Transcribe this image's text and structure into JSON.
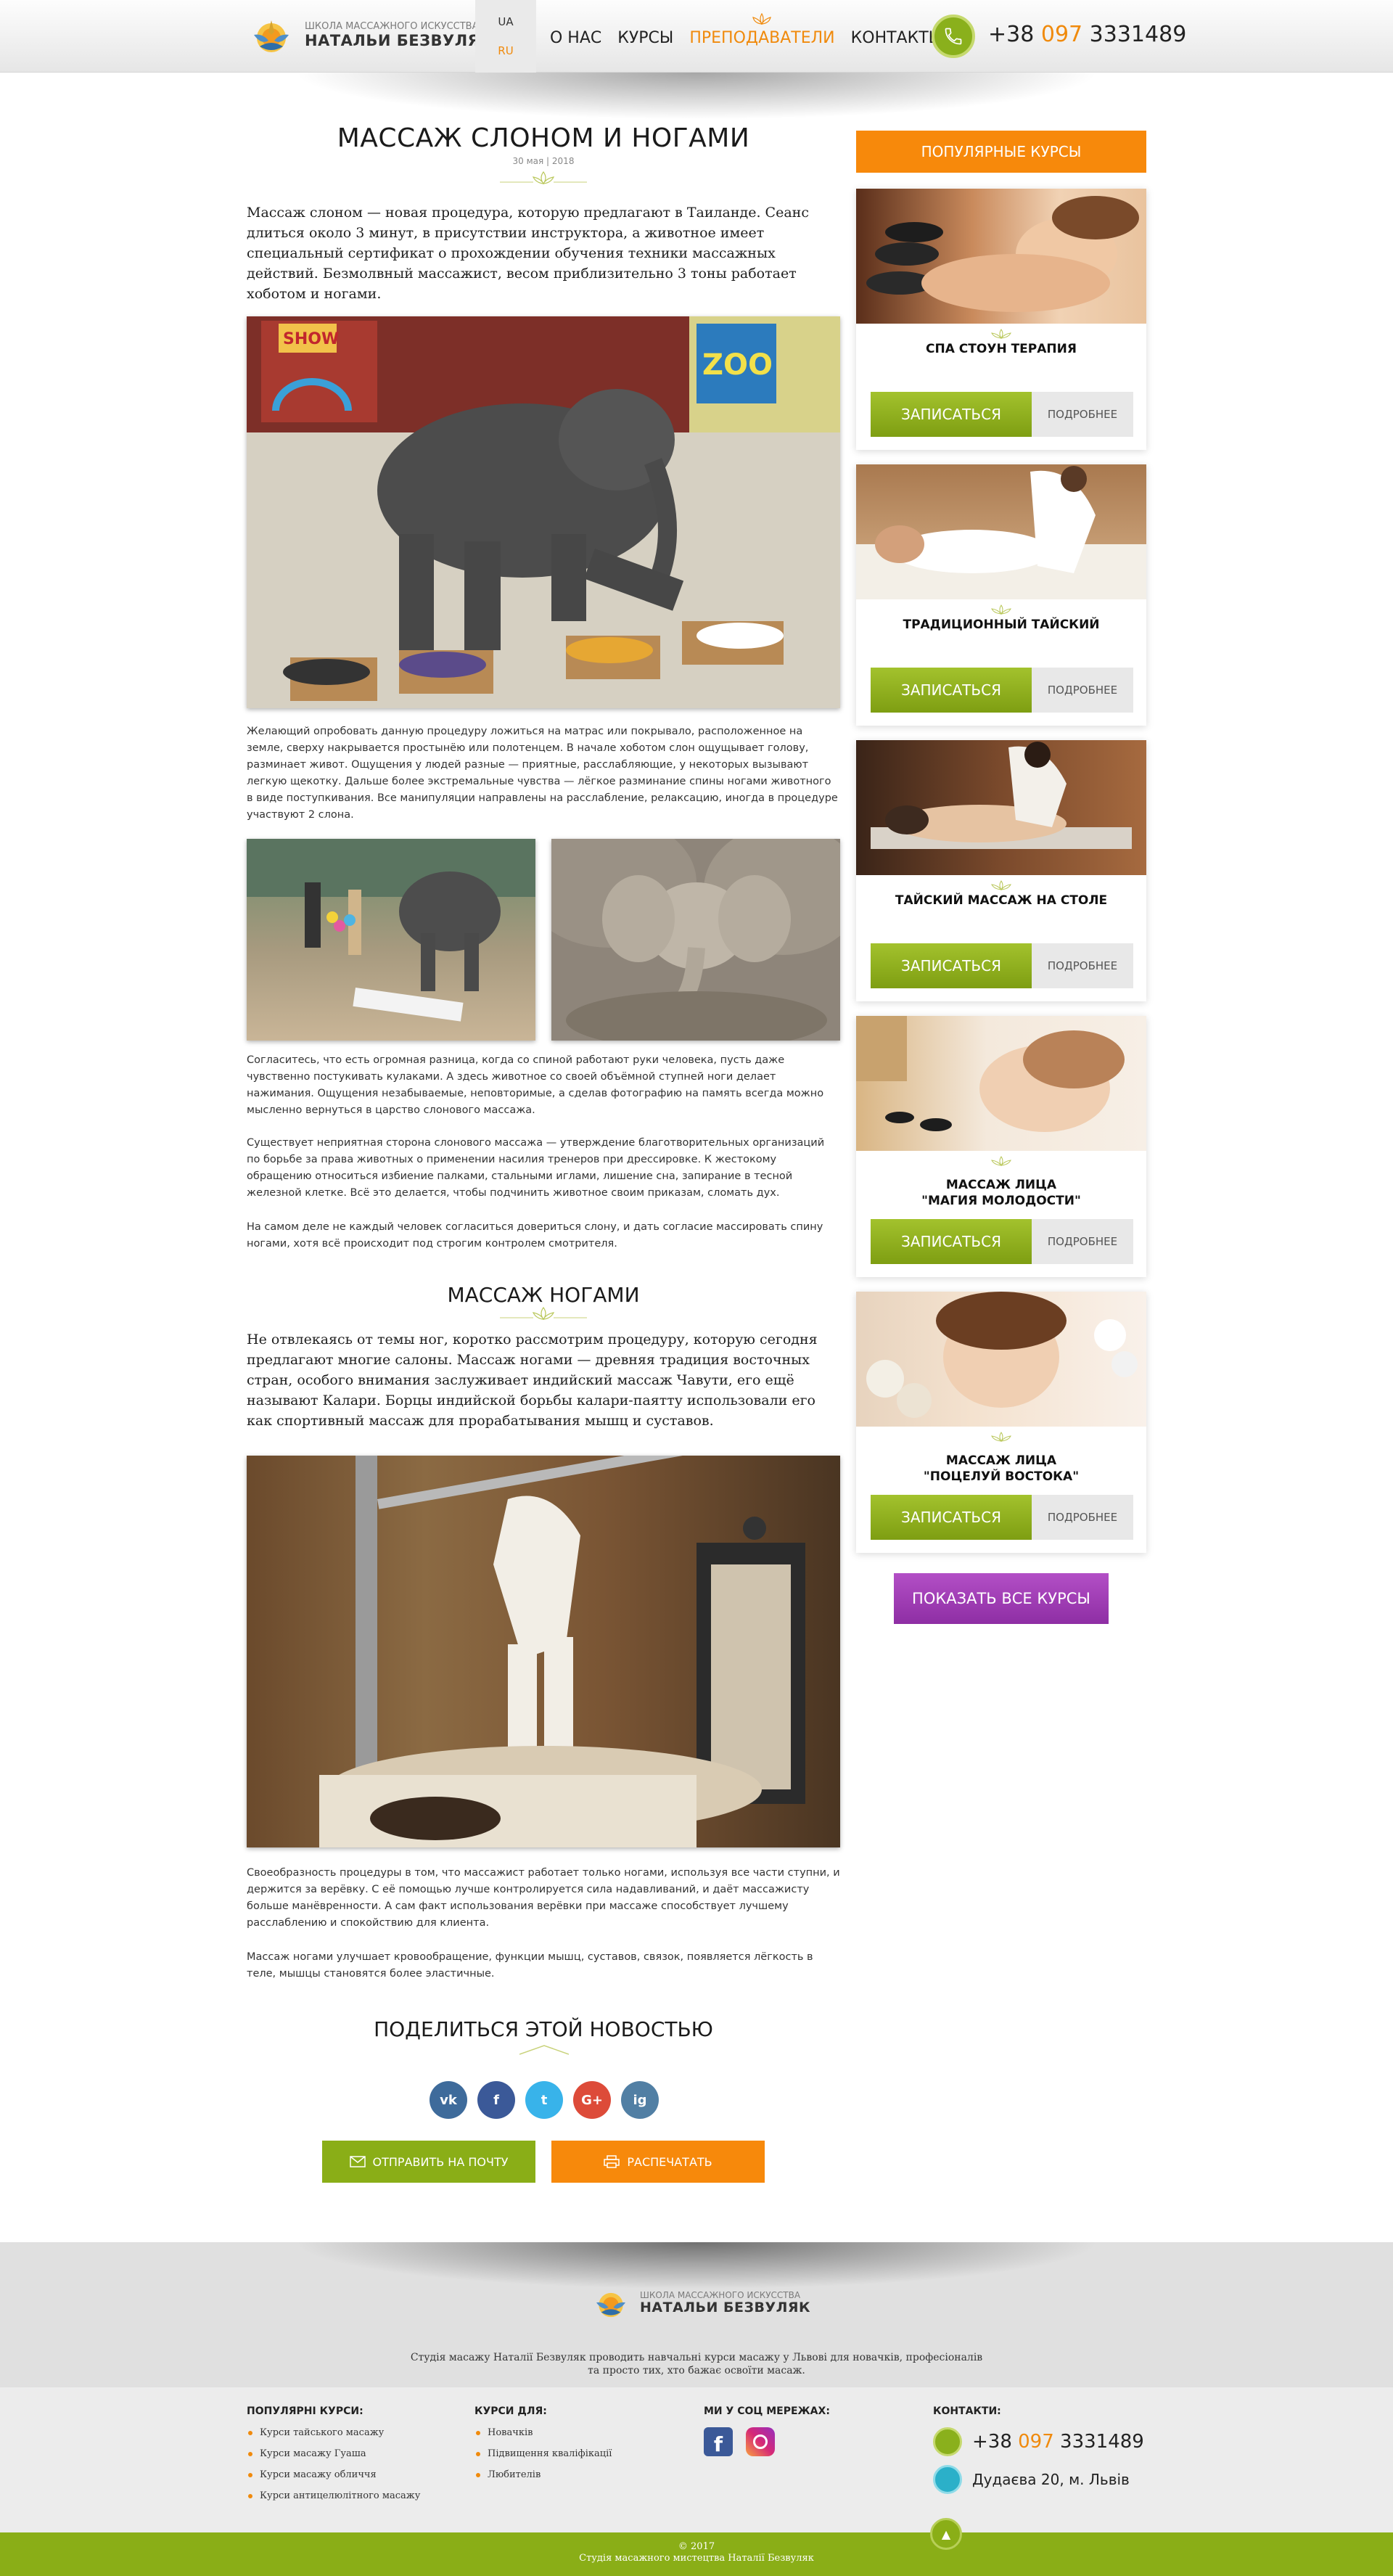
{
  "header": {
    "logo_sub": "ШКОЛА МАССАЖНОГО ИСКУССТВА",
    "logo_main": "НАТАЛЬИ БЕЗВУЛЯК",
    "lang_ua": "UA",
    "lang_ru": "RU",
    "nav": [
      "О НАС",
      "КУРСЫ",
      "ПРЕПОДАВАТЕЛИ",
      "КОНТАКТЫ"
    ],
    "phone_prefix": "+38",
    "phone_op": "097",
    "phone_num": "3331489"
  },
  "article": {
    "title": "МАССАЖ СЛОНОМ И НОГАМИ",
    "date": "30 мая | 2018",
    "lead": "Массаж слоном — новая процедура, которую предлагают в Таиланде. Сеанс длиться около 3 минут, в присутствии инструктора, а животное имеет специальный сертификат о прохождении обучения техники массажных действий. Безмолвный массажист, весом приблизительно 3 тоны работает хоботом и ногами.",
    "p1": "Желающий опробовать данную процедуру ложиться на матрас или покрывало, расположенное на земле, сверху накрывается простынёю или полотенцем. В начале хоботом слон ощущывает голову, разминает живот. Ощущения у людей разные — приятные, расслабляющие, у некоторых вызывают легкую щекотку. Дальше более экстремальные чувства — лёгкое разминание спины ногами животного в виде поступкивания. Все манипуляции направлены на расслабление, релаксацию, иногда в процедуре участвуют 2 слона.",
    "p2": "Согласитесь, что есть огромная разница, когда со спиной работают руки человека, пусть даже чувственно постукивать кулаками. А здесь животное со своей объёмной ступней ноги делает нажимания. Ощущения незабываемые, неповторимые, а сделав фотографию на память всегда можно мысленно вернуться в царство слонового массажа.",
    "p3": "Существует неприятная сторона слонового массажа — утверждение благотворительных организаций по борьбе за права животных о применении насилия тренеров при дрессировке. К жестокому обращению относиться избиение палками, стальными иглами, лишение сна, запирание в тесной железной клетке. Всё это делается, чтобы подчинить животное своим приказам, сломать дух.",
    "p4": "На самом деле не каждый человек согласиться довериться слону, и дать согласие массировать спину ногами, хотя всё происходит под строгим контролем смотрителя.",
    "h2": "МАССАЖ НОГАМИ",
    "lead2": "Не отвлекаясь от темы ног, коротко рассмотрим процедуру, которую сегодня предлагают многие салоны. Массаж ногами — древняя традиция восточных стран, особого внимания заслуживает индийский массаж Чавути, его ещё называют Калари. Борцы индийской борьбы калари-паятту использовали его как спортивный массаж для прорабатывания мышц и суставов.",
    "p5": "Своеобразность процедуры в том, что массажист работает только ногами, используя все части ступни, и держится за верёвку. С её помощью лучше контролируется сила надавливаний, и даёт массажисту больше манёвренности. А сам факт использования верёвки при массаже способствует лучшему расслаблению и спокойствию для клиента.",
    "p6": "Массаж ногами улучшает кровообращение, функции мышц, суставов, связок, появляется лёгкость в теле, мышцы становятся более эластичные.",
    "share_title": "ПОДЕЛИТЬСЯ ЭТОЙ НОВОСТЬЮ",
    "social": [
      "vk",
      "f",
      "t",
      "G+",
      "ig"
    ],
    "send_btn": "ОТПРАВИТЬ НА ПОЧТУ",
    "print_btn": "РАСПЕЧАТАТЬ",
    "zoo_sign": "SHOW"
  },
  "sidebar": {
    "header": "ПОПУЛЯРНЫЕ КУРСЫ",
    "courses": [
      {
        "title": "СПА СТОУН ТЕРАПИЯ"
      },
      {
        "title": "ТРАДИЦИОННЫЙ ТАЙСКИЙ"
      },
      {
        "title": "ТАЙСКИЙ МАССАЖ НА СТОЛЕ"
      },
      {
        "title": "МАССАЖ ЛИЦА\n\"МАГИЯ МОЛОДОСТИ\""
      },
      {
        "title": "МАССАЖ ЛИЦА\n\"ПОЦЕЛУЙ ВОСТОКА\""
      }
    ],
    "enroll_label": "ЗАПИСАТЬСЯ",
    "more_label": "ПОДРОБНЕЕ",
    "show_all": "ПОКАЗАТЬ ВСЕ КУРСЫ"
  },
  "footer": {
    "logo_sub": "ШКОЛА МАССАЖНОГО ИСКУССТВА",
    "logo_main": "НАТАЛЬИ БЕЗВУЛЯК",
    "text": "Студія масажу Наталії Безвуляк проводить навчальні курси масажу у Львові для новачків, професіоналів та просто тих, хто бажає освоїти масаж.",
    "col1_title": "ПОПУЛЯРНІ КУРСИ:",
    "col1": [
      "Курси тайського масажу",
      "Курси масажу Гуаша",
      "Курси масажу обличчя",
      "Курси антицелюлітного масажу"
    ],
    "col2_title": "КУРСИ ДЛЯ:",
    "col2": [
      "Новачків",
      "Підвищення кваліфікації",
      "Любителів"
    ],
    "col3_title": "МИ У СОЦ МЕРЕЖАХ:",
    "col4_title": "КОНТАКТИ:",
    "phone_prefix": "+38",
    "phone_op": "097",
    "phone_num": "3331489",
    "address": "Дудаєва 20, м. Львів",
    "copyright": "© 2017",
    "studio": "Студія масажного мистецтва Наталії Безвуляк"
  },
  "colors": {
    "accent": "#f08a0c",
    "green": "#8aae17",
    "purple": "#9b3ab1"
  }
}
